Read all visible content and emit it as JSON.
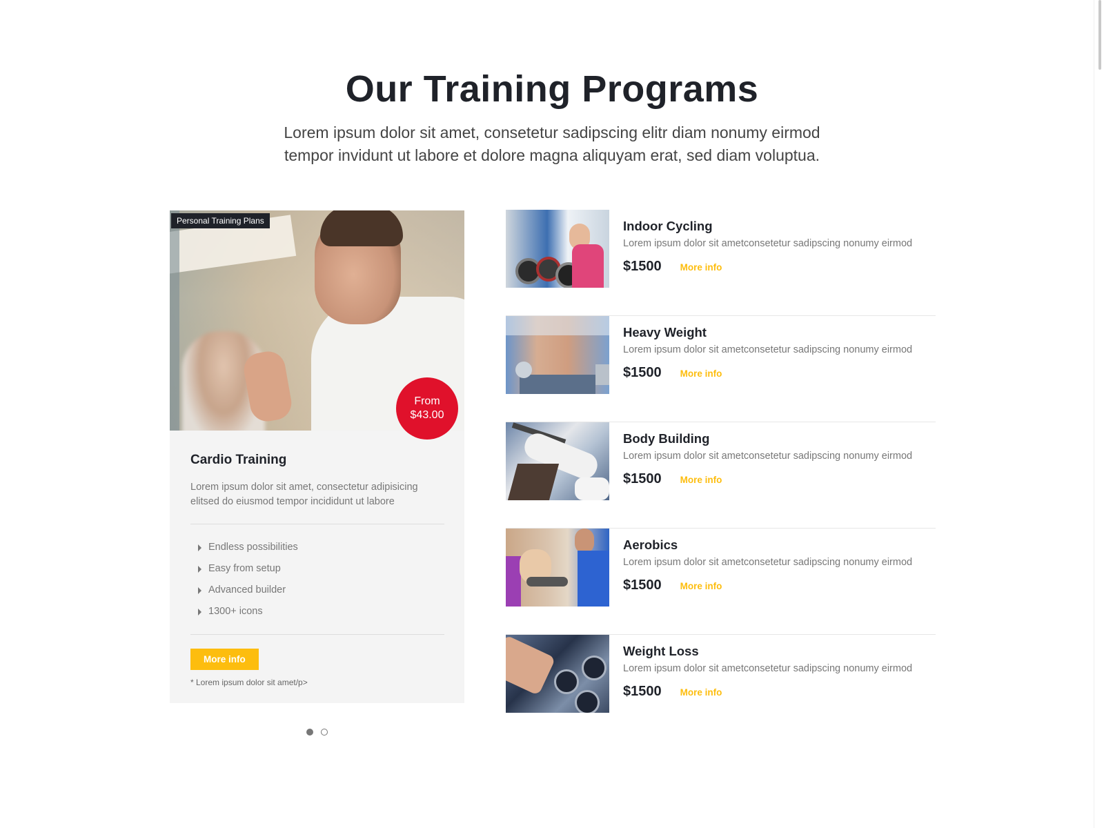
{
  "header": {
    "title": "Our Training Programs",
    "subtitle": "Lorem ipsum dolor sit amet, consetetur sadipscing elitr diam nonumy eirmod tempor invidunt ut labore et dolore magna aliquyam erat, sed diam voluptua."
  },
  "featured": {
    "category": "Personal Training Plans",
    "price_line1": "From",
    "price_line2": "$43.00",
    "title": "Cardio Training",
    "description": "Lorem ipsum dolor sit amet, consectetur adipisicing elitsed do eiusmod tempor incididunt ut labore",
    "features": [
      "Endless possibilities",
      "Easy from setup",
      "Advanced builder",
      "1300+ icons"
    ],
    "button_label": "More info",
    "footnote": "* Lorem ipsum dolor sit amet/p>"
  },
  "carousel": {
    "active_index": 0,
    "count": 2
  },
  "programs": [
    {
      "title": "Indoor Cycling",
      "description": "Lorem ipsum dolor sit ametconsetetur sadipscing nonumy eirmod",
      "price": "$1500",
      "link_label": "More info"
    },
    {
      "title": "Heavy Weight",
      "description": "Lorem ipsum dolor sit ametconsetetur sadipscing nonumy eirmod",
      "price": "$1500",
      "link_label": "More info"
    },
    {
      "title": "Body Building",
      "description": "Lorem ipsum dolor sit ametconsetetur sadipscing nonumy eirmod",
      "price": "$1500",
      "link_label": "More info"
    },
    {
      "title": "Aerobics",
      "description": "Lorem ipsum dolor sit ametconsetetur sadipscing nonumy eirmod",
      "price": "$1500",
      "link_label": "More info"
    },
    {
      "title": "Weight Loss",
      "description": "Lorem ipsum dolor sit ametconsetetur sadipscing nonumy eirmod",
      "price": "$1500",
      "link_label": "More info"
    }
  ],
  "colors": {
    "accent": "#fdbd0e",
    "badge_red": "#e0112b",
    "heading": "#1f2229",
    "body_text": "#777777"
  }
}
